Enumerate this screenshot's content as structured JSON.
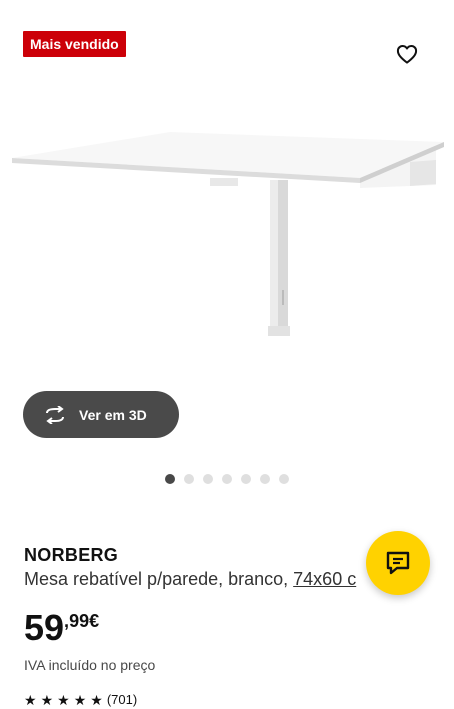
{
  "badge": {
    "label": "Mais vendido"
  },
  "product": {
    "name": "NORBERG",
    "description": "Mesa rebatível p/parede, branco, ",
    "dimensions": "74x60 c",
    "price_integer": "59",
    "price_separator": ",",
    "price_decimals": "99",
    "currency": "€",
    "vat_note": "IVA incluído no preço"
  },
  "view3d": {
    "label": "Ver em 3D"
  },
  "carousel": {
    "count": 7,
    "active_index": 0
  },
  "rating": {
    "stars": 5,
    "count": "(701)"
  },
  "icons": {
    "favorite": "heart-outline-icon",
    "view3d": "rotate-3d-icon",
    "chat": "chat-bubble-icon"
  },
  "colors": {
    "badge": "#cc0008",
    "chat_button": "#ffd200",
    "view3d_button": "#4a4a4a"
  }
}
